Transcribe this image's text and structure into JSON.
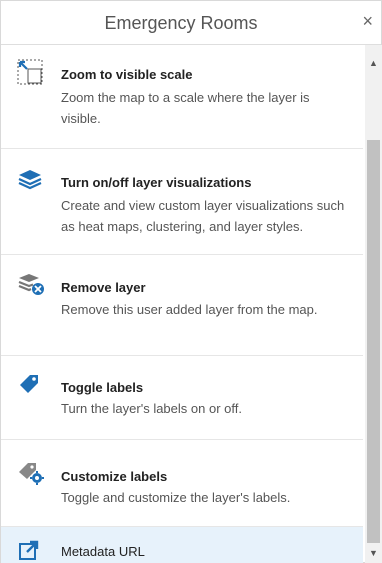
{
  "header": {
    "title": "Emergency Rooms",
    "close_glyph": "×"
  },
  "items": [
    {
      "icon": "zoom-to-scale-icon",
      "label": "Zoom to visible scale",
      "description": "Zoom the map to a scale where the layer is visible."
    },
    {
      "icon": "layers-icon",
      "label": "Turn on/off layer visualizations",
      "description": "Create and view custom layer visualizations such as heat maps, clustering, and layer styles."
    },
    {
      "icon": "remove-layer-icon",
      "label": "Remove layer",
      "description": "Remove this user added layer from the map."
    },
    {
      "icon": "tag-icon",
      "label": "Toggle labels",
      "description": "Turn the layer's labels on or off."
    },
    {
      "icon": "tag-gear-icon",
      "label": "Customize labels",
      "description": "Toggle and customize the layer's labels."
    },
    {
      "icon": "external-link-icon",
      "label": "Metadata URL",
      "description": ""
    }
  ],
  "scrollbar": {
    "up_glyph": "▲",
    "down_glyph": "▼"
  },
  "colors": {
    "accent": "#1f6fb5",
    "active_bg": "#e7f2fb"
  }
}
